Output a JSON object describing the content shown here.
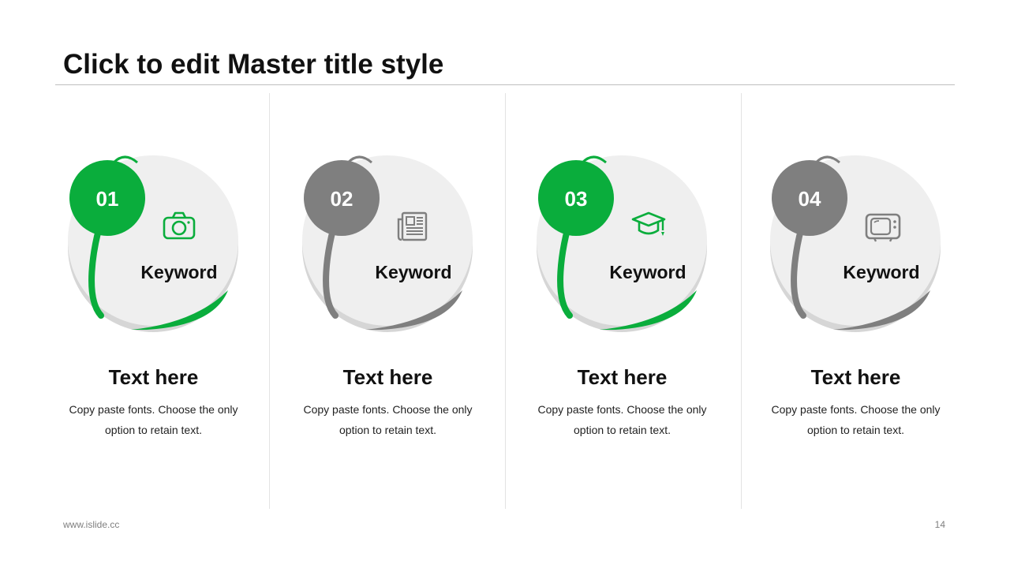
{
  "title": "Click to edit Master title style",
  "colors": {
    "accent": "#0aad3c",
    "neutral": "#7f7f7f",
    "circle": "#efefef",
    "shadow": "#d6d6d6"
  },
  "columns": [
    {
      "number": "01",
      "keyword": "Keyword",
      "icon": "camera-icon",
      "color": "#0aad3c",
      "heading": "Text here",
      "body": "Copy paste fonts. Choose the only option to retain text."
    },
    {
      "number": "02",
      "keyword": "Keyword",
      "icon": "newspaper-icon",
      "color": "#7f7f7f",
      "heading": "Text here",
      "body": "Copy paste fonts. Choose the only option to retain text."
    },
    {
      "number": "03",
      "keyword": "Keyword",
      "icon": "graduation-cap-icon",
      "color": "#0aad3c",
      "heading": "Text here",
      "body": "Copy paste fonts. Choose the only option to retain text."
    },
    {
      "number": "04",
      "keyword": "Keyword",
      "icon": "television-icon",
      "color": "#7f7f7f",
      "heading": "Text here",
      "body": "Copy paste fonts. Choose the only option to retain text."
    }
  ],
  "footer": {
    "website": "www.islide.cc",
    "page_number": "14"
  }
}
